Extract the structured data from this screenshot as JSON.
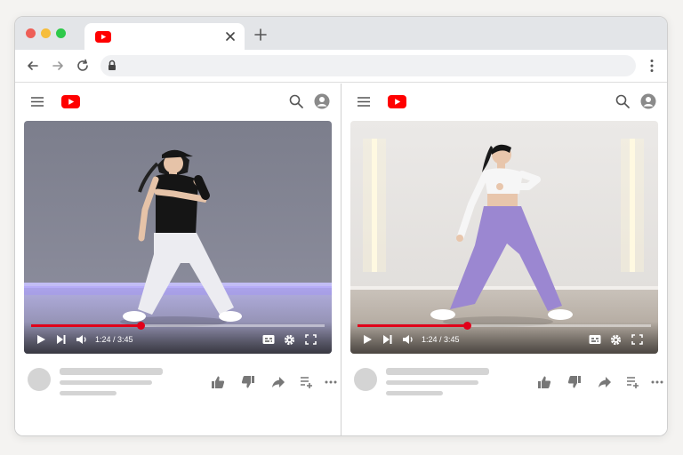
{
  "browser": {
    "traffic_lights": [
      "#ee5f57",
      "#f6bd3b",
      "#2ec94a"
    ],
    "tab_icon": "youtube-logo-icon",
    "tab_close_icon": "close-icon",
    "new_tab_icon": "plus-icon",
    "nav_icons": [
      "arrow-left-icon",
      "arrow-right-icon",
      "reload-icon"
    ],
    "address_icon": "lock-icon",
    "menu_icon": "kebab-menu-icon"
  },
  "colors": {
    "brand_red": "#ff0000",
    "progress_red": "#e1001a",
    "placeholder_gray": "#d4d4d4",
    "icon_gray": "#7a7a7a"
  },
  "players": [
    {
      "time": "1:24 / 3:45",
      "progress": 0.373,
      "icons": [
        "menu-icon",
        "youtube-logo-icon",
        "search-icon",
        "account-icon",
        "play-icon",
        "next-icon",
        "volume-icon",
        "captions-icon",
        "settings-icon",
        "fullscreen-icon"
      ],
      "actions": [
        "like-icon",
        "dislike-icon",
        "share-icon",
        "add-to-playlist-icon",
        "more-icon"
      ]
    },
    {
      "time": "1:24 / 3:45",
      "progress": 0.373,
      "icons": [
        "menu-icon",
        "youtube-logo-icon",
        "search-icon",
        "account-icon",
        "play-icon",
        "next-icon",
        "volume-icon",
        "captions-icon",
        "settings-icon",
        "fullscreen-icon"
      ],
      "actions": [
        "like-icon",
        "dislike-icon",
        "share-icon",
        "add-to-playlist-icon",
        "more-icon"
      ]
    }
  ]
}
